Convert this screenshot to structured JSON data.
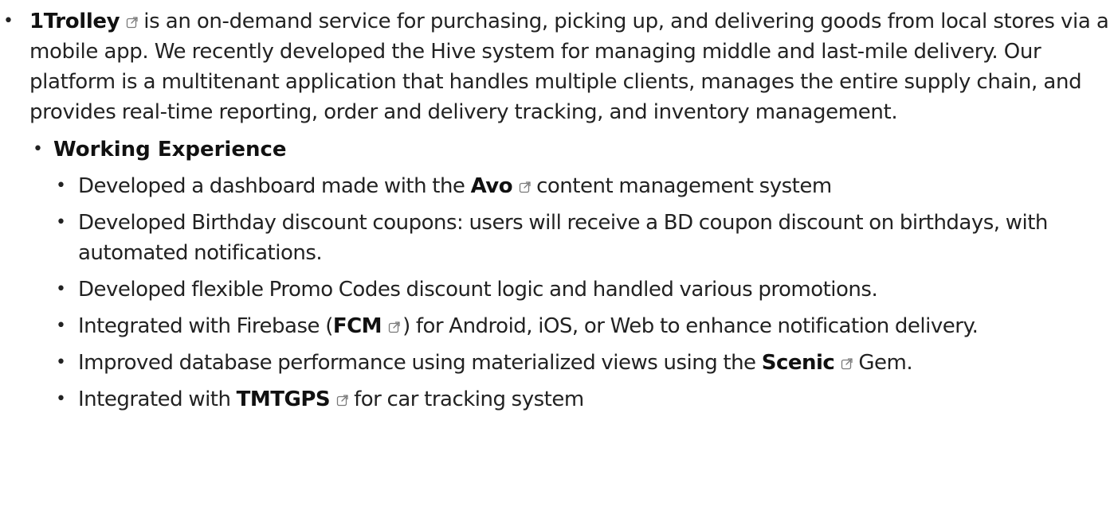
{
  "company": {
    "name": "1Trolley",
    "description": "is an on-demand service for purchasing, picking up, and delivering goods from local stores via a mobile app. We recently developed the Hive system for managing middle and last-mile delivery. Our platform is a multitenant application that handles multiple clients, manages the entire supply chain, and provides real-time reporting, order and delivery tracking, and inventory management."
  },
  "section": {
    "title": "Working Experience"
  },
  "items": [
    {
      "before": "Developed a dashboard made with the",
      "link": "Avo",
      "after": "content management system"
    },
    {
      "text": "Developed Birthday discount coupons: users will receive a BD coupon discount on birthdays, with automated notifications."
    },
    {
      "text": "Developed flexible Promo Codes discount logic and handled various promotions."
    },
    {
      "before": "Integrated with Firebase (",
      "link": "FCM",
      "after": ") for Android, iOS, or Web to enhance notification delivery."
    },
    {
      "before": "Improved database performance using materialized views using the",
      "link": "Scenic",
      "after": "Gem."
    },
    {
      "before": "Integrated with",
      "link": "TMTGPS",
      "after": "for car tracking system"
    }
  ],
  "icons": {
    "bullet": "•",
    "external_link": "external-link-icon"
  }
}
